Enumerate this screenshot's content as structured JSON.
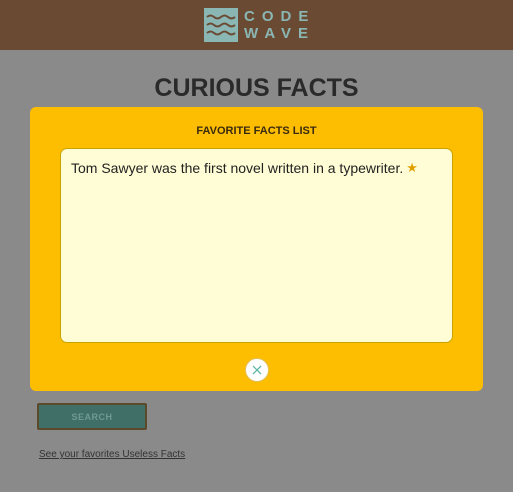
{
  "header": {
    "logo_line1": "CODE",
    "logo_line2": "WAVE"
  },
  "page": {
    "title": "CURIOUS FACTS",
    "search_label": "SEARCH",
    "favorites_link": "See your favorites Useless Facts"
  },
  "modal": {
    "title": "FAVORITE FACTS LIST",
    "facts": [
      "Tom Sawyer was the first novel written in a typewriter."
    ],
    "close_icon": "close-icon",
    "star_icon": "star-icon"
  },
  "colors": {
    "header": "#6b4a33",
    "modal": "#fdbd00",
    "facts_box": "#fffdd5",
    "accent": "#3f6f66"
  }
}
